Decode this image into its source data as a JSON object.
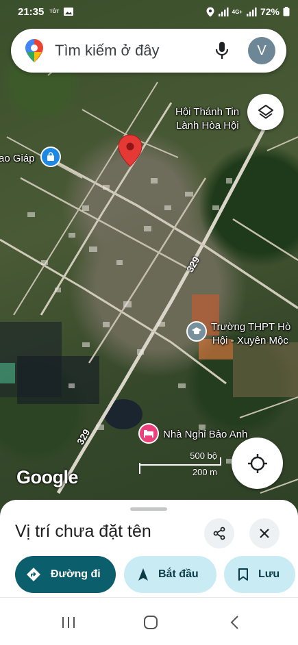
{
  "status_bar": {
    "time": "21:35",
    "tot": "TÔT",
    "network": "4G+",
    "battery": "72%"
  },
  "search": {
    "placeholder": "Tìm kiếm ở đây",
    "avatar_letter": "V"
  },
  "map": {
    "labels": {
      "church": "Hội Thánh Tin\nLành Hòa Hội",
      "church_line1": "Hội Thánh Tin",
      "church_line2": "Lành Hòa Hội",
      "left_poi": "ao Giáp",
      "school_line1": "Trường THPT Hò",
      "school_line2": "Hội - Xuyên Mộc",
      "hotel": "Nhà Nghỉ Bảo Anh",
      "route_top": "329",
      "route_bottom": "329"
    },
    "scale": {
      "top": "500 bộ",
      "bottom": "200 m"
    },
    "logo": "Google"
  },
  "sheet": {
    "title": "Vị trí chưa đặt tên",
    "buttons": {
      "directions": "Đường đi",
      "start": "Bắt đầu",
      "save": "Lưu"
    }
  },
  "colors": {
    "pin": "#e53935",
    "poi_blue": "#1e88e5",
    "poi_pink": "#ec407a",
    "poi_gray": "#78909c",
    "primary": "#0b5e6b",
    "secondary": "#c9ecf4"
  },
  "icons": [
    "maps-logo-icon",
    "mic-icon",
    "layers-icon",
    "locate-icon",
    "share-icon",
    "close-icon",
    "directions-icon",
    "navigation-arrow-icon",
    "bookmark-icon",
    "recents-icon",
    "home-icon",
    "back-icon"
  ]
}
